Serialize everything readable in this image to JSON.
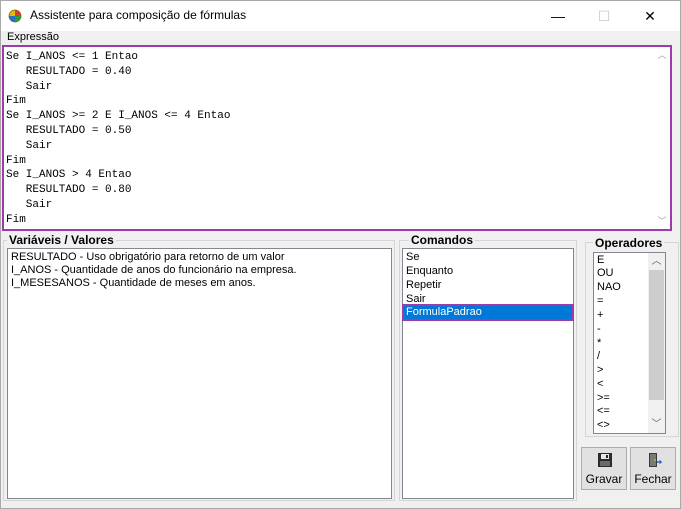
{
  "window": {
    "title": "Assistente para composição de fórmulas",
    "minimize_glyph": "—",
    "maximize_glyph": "☐",
    "close_glyph": "✕"
  },
  "menu": {
    "items": [
      {
        "label": "Expressão"
      }
    ]
  },
  "editor": {
    "text": "Se I_ANOS <= 1 Entao\n   RESULTADO = 0.40\n   Sair\nFim\nSe I_ANOS >= 2 E I_ANOS <= 4 Entao\n   RESULTADO = 0.50\n   Sair\nFim\nSe I_ANOS > 4 Entao\n   RESULTADO = 0.80\n   Sair\nFim"
  },
  "variables": {
    "title": "Variáveis / Valores",
    "items": [
      "RESULTADO - Uso obrigatório para retorno de um valor",
      "I_ANOS - Quantidade de anos do funcionário na empresa.",
      "I_MESESANOS - Quantidade de meses em anos."
    ]
  },
  "commands": {
    "title": "Comandos",
    "items": [
      "Se",
      "Enquanto",
      "Repetir",
      "Sair",
      "FormulaPadrao"
    ],
    "selected": "FormulaPadrao"
  },
  "operators": {
    "title": "Operadores",
    "items": [
      "E",
      "OU",
      "NAO",
      "=",
      "+",
      "-",
      "*",
      "/",
      ">",
      "<",
      ">=",
      "<=",
      "<>"
    ]
  },
  "buttons": {
    "save_label": "Gravar",
    "close_label": "Fechar"
  },
  "colors": {
    "accent": "#9c3ca8",
    "selection": "#0078d7"
  }
}
